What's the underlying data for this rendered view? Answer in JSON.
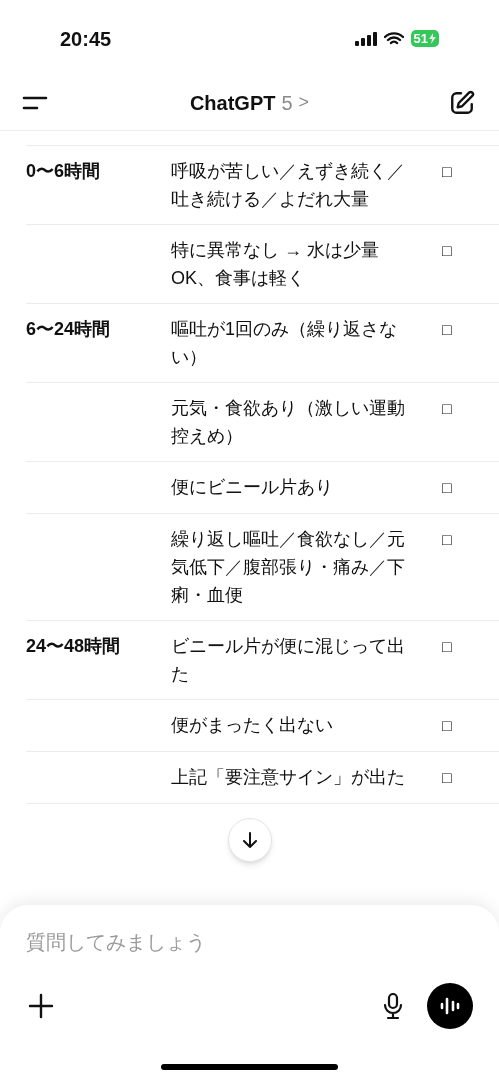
{
  "status_bar": {
    "time": "20:45",
    "battery": "51"
  },
  "header": {
    "title": "ChatGPT",
    "model": "5",
    "chevron": ">"
  },
  "table": {
    "rows": [
      {
        "time": "0〜6時間",
        "sign": "呼吸が苦しい／えずき続く／吐き続ける／よだれ大量",
        "box": "□"
      },
      {
        "sign": "特に異常なし → 水は少量 OK、食事は軽く",
        "box": "□"
      },
      {
        "time": "6〜24時間",
        "sign": "嘔吐が1回のみ（繰り返さない）",
        "box": "□"
      },
      {
        "sign": "元気・食欲あり（激しい運動控えめ）",
        "box": "□"
      },
      {
        "sign": "便にビニール片あり",
        "box": "□"
      },
      {
        "sign": "繰り返し嘔吐／食欲なし／元気低下／腹部張り・痛み／下痢・血便",
        "box": "□"
      },
      {
        "time": "24〜48時間",
        "sign": "ビニール片が便に混じって出た",
        "box": "□"
      },
      {
        "sign": "便がまったく出ない",
        "box": "□"
      },
      {
        "sign": "上記「要注意サイン」が出た",
        "box": "□"
      }
    ]
  },
  "composer": {
    "placeholder": "質問してみましょう"
  }
}
